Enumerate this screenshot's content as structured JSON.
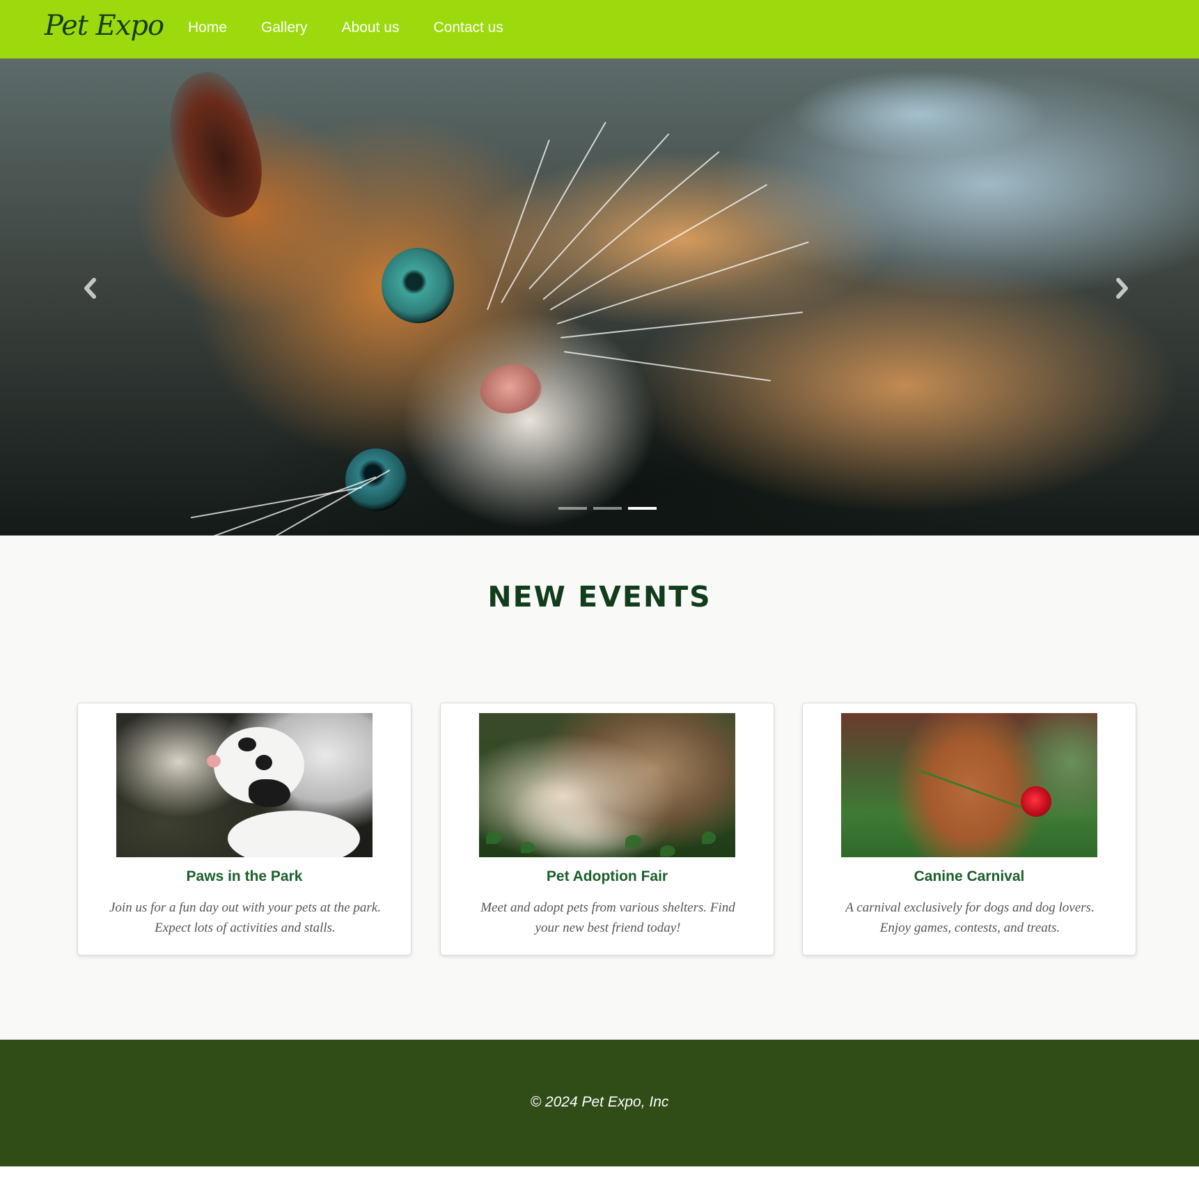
{
  "navbar": {
    "brand": "Pet Expo",
    "links": [
      "Home",
      "Gallery",
      "About us",
      "Contact us"
    ],
    "background_color": "#9cda0d"
  },
  "hero": {
    "image_description_icon": "cat-photo",
    "prev_icon": "chevron-left-icon",
    "next_icon": "chevron-right-icon",
    "slide_count": 3,
    "active_slide": 3
  },
  "events": {
    "title": "NEW EVENTS",
    "cards": [
      {
        "title": "Paws in the Park",
        "text": "Join us for a fun day out with your pets at the park. Expect lots of activities and stalls."
      },
      {
        "title": "Pet Adoption Fair",
        "text": "Meet and adopt pets from various shelters. Find your new best friend today!"
      },
      {
        "title": "Canine Carnival",
        "text": "A carnival exclusively for dogs and dog lovers. Enjoy games, contests, and treats."
      }
    ]
  },
  "footer": {
    "text": "© 2024 Pet Expo, Inc",
    "background_color": "#304d18"
  }
}
